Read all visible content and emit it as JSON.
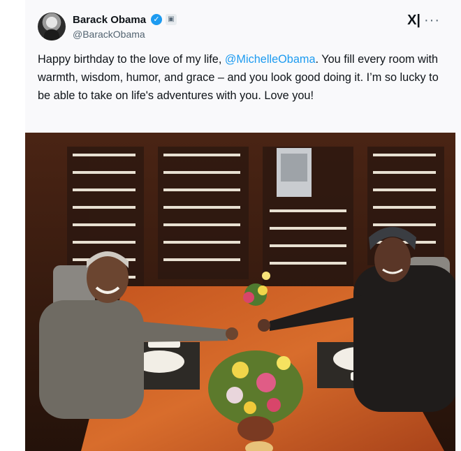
{
  "author": {
    "name": "Barack Obama",
    "handle": "@BarackObama",
    "verified": true,
    "government_badge": true
  },
  "header_icons": {
    "grok_icon": "xai-grok-icon",
    "more_icon": "more-options-icon",
    "grok_glyph": "X|",
    "more_glyph": "···"
  },
  "tweet": {
    "text_before": "Happy birthday to the love of my life, ",
    "mention": "@MichelleObama",
    "text_after": ". You fill every room with warmth, wisdom, humor, and grace – and you look good doing it. I’m so lucky to be able to take on life's adventures with you. Love you!"
  },
  "colors": {
    "accent": "#1d9bf0",
    "text": "#0f1419",
    "secondary": "#536471"
  }
}
